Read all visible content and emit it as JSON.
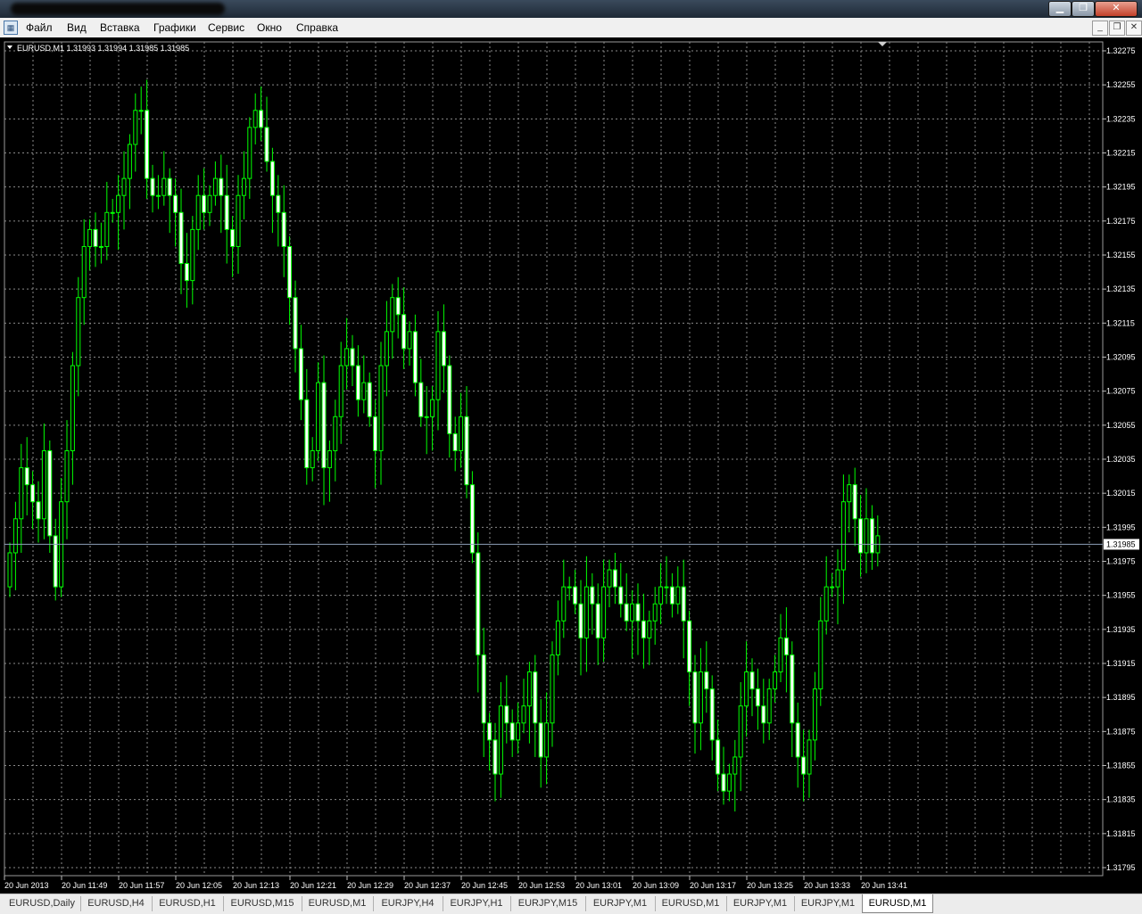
{
  "menu": {
    "items": [
      "Файл",
      "Вид",
      "Вставка",
      "Графики",
      "Сервис",
      "Окно",
      "Справка"
    ]
  },
  "icons": {
    "app": "app-icon",
    "minimize": "minimize-icon",
    "restore": "restore-icon",
    "close": "close-icon",
    "legend_arrow": "dropdown-triangle-icon"
  },
  "chart": {
    "legend": "EURUSD,M1  1.31993 1.31994 1.31985 1.31985",
    "current_price_label": "1.31985",
    "current_price": 1.31985,
    "price_ticks": [
      "1.32275",
      "1.32255",
      "1.32235",
      "1.32215",
      "1.32195",
      "1.32175",
      "1.32155",
      "1.32135",
      "1.32115",
      "1.32095",
      "1.32075",
      "1.32055",
      "1.32035",
      "1.32015",
      "1.31995",
      "1.31975",
      "1.31955",
      "1.31935",
      "1.31915",
      "1.31895",
      "1.31875",
      "1.31855",
      "1.31835",
      "1.31815",
      "1.31795"
    ],
    "time_ticks": [
      "20 Jun 2013",
      "20 Jun 11:49",
      "20 Jun 11:57",
      "20 Jun 12:05",
      "20 Jun 12:13",
      "20 Jun 12:21",
      "20 Jun 12:29",
      "20 Jun 12:37",
      "20 Jun 12:45",
      "20 Jun 12:53",
      "20 Jun 13:01",
      "20 Jun 13:09",
      "20 Jun 13:17",
      "20 Jun 13:25",
      "20 Jun 13:33",
      "20 Jun 13:41"
    ],
    "colors": {
      "background": "#000000",
      "grid": "#8a8a8a",
      "candle": "#00ff00",
      "bull_body": "#000000",
      "bear_body": "#ffffff",
      "price_line": "#8ea0b8",
      "axis_text": "#ffffff"
    }
  },
  "chart_data": {
    "type": "candlestick",
    "symbol": "EURUSD",
    "timeframe": "M1",
    "ylim": [
      1.31795,
      1.32275
    ],
    "candle_closes": [
      1.3198,
      1.32,
      1.3203,
      1.3202,
      1.3201,
      1.32,
      1.3204,
      1.3199,
      1.3196,
      1.3201,
      1.3204,
      1.3209,
      1.3213,
      1.3216,
      1.3217,
      1.3216,
      1.3216,
      1.3218,
      1.3218,
      1.3219,
      1.322,
      1.3222,
      1.3224,
      1.3224,
      1.322,
      1.3219,
      1.3219,
      1.322,
      1.3219,
      1.3218,
      1.3215,
      1.3214,
      1.3217,
      1.3219,
      1.3218,
      1.3219,
      1.322,
      1.3219,
      1.3217,
      1.3216,
      1.3219,
      1.322,
      1.3223,
      1.3224,
      1.3223,
      1.3221,
      1.3219,
      1.3218,
      1.3216,
      1.3213,
      1.321,
      1.3207,
      1.3203,
      1.3204,
      1.3208,
      1.3203,
      1.3204,
      1.3206,
      1.3209,
      1.321,
      1.3209,
      1.3207,
      1.3208,
      1.3206,
      1.3204,
      1.3209,
      1.3211,
      1.3213,
      1.3212,
      1.321,
      1.3211,
      1.3208,
      1.3206,
      1.3206,
      1.3207,
      1.3211,
      1.3209,
      1.3205,
      1.3204,
      1.3206,
      1.3202,
      1.3198,
      1.3192,
      1.3188,
      1.3187,
      1.3185,
      1.3189,
      1.3188,
      1.3187,
      1.3188,
      1.3189,
      1.3191,
      1.3188,
      1.3186,
      1.3188,
      1.3192,
      1.3194,
      1.3196,
      1.3196,
      1.3195,
      1.3193,
      1.3196,
      1.3195,
      1.3193,
      1.3196,
      1.3197,
      1.3196,
      1.3195,
      1.3194,
      1.3195,
      1.3194,
      1.3193,
      1.3194,
      1.3195,
      1.3196,
      1.3196,
      1.3195,
      1.3196,
      1.3194,
      1.3191,
      1.3188,
      1.3191,
      1.319,
      1.3187,
      1.3185,
      1.3184,
      1.3185,
      1.3186,
      1.3189,
      1.3191,
      1.319,
      1.3189,
      1.3188,
      1.319,
      1.3191,
      1.3193,
      1.3192,
      1.3188,
      1.3186,
      1.3185,
      1.3187,
      1.319,
      1.3194,
      1.3196,
      1.3196,
      1.3197,
      1.3201,
      1.3202,
      1.32,
      1.3198,
      1.32,
      1.3198,
      1.3199
    ]
  },
  "tabs": [
    {
      "label": "EURUSD,Daily",
      "active": false
    },
    {
      "label": "EURUSD,H4",
      "active": false
    },
    {
      "label": "EURUSD,H1",
      "active": false
    },
    {
      "label": "EURUSD,M15",
      "active": false
    },
    {
      "label": "EURUSD,M1",
      "active": false
    },
    {
      "label": "EURJPY,H4",
      "active": false
    },
    {
      "label": "EURJPY,H1",
      "active": false
    },
    {
      "label": "EURJPY,M15",
      "active": false
    },
    {
      "label": "EURJPY,M1",
      "active": false
    },
    {
      "label": "EURUSD,M1",
      "active": false
    },
    {
      "label": "EURJPY,M1",
      "active": false
    },
    {
      "label": "EURJPY,M1",
      "active": false
    },
    {
      "label": "EURUSD,M1",
      "active": true
    }
  ]
}
